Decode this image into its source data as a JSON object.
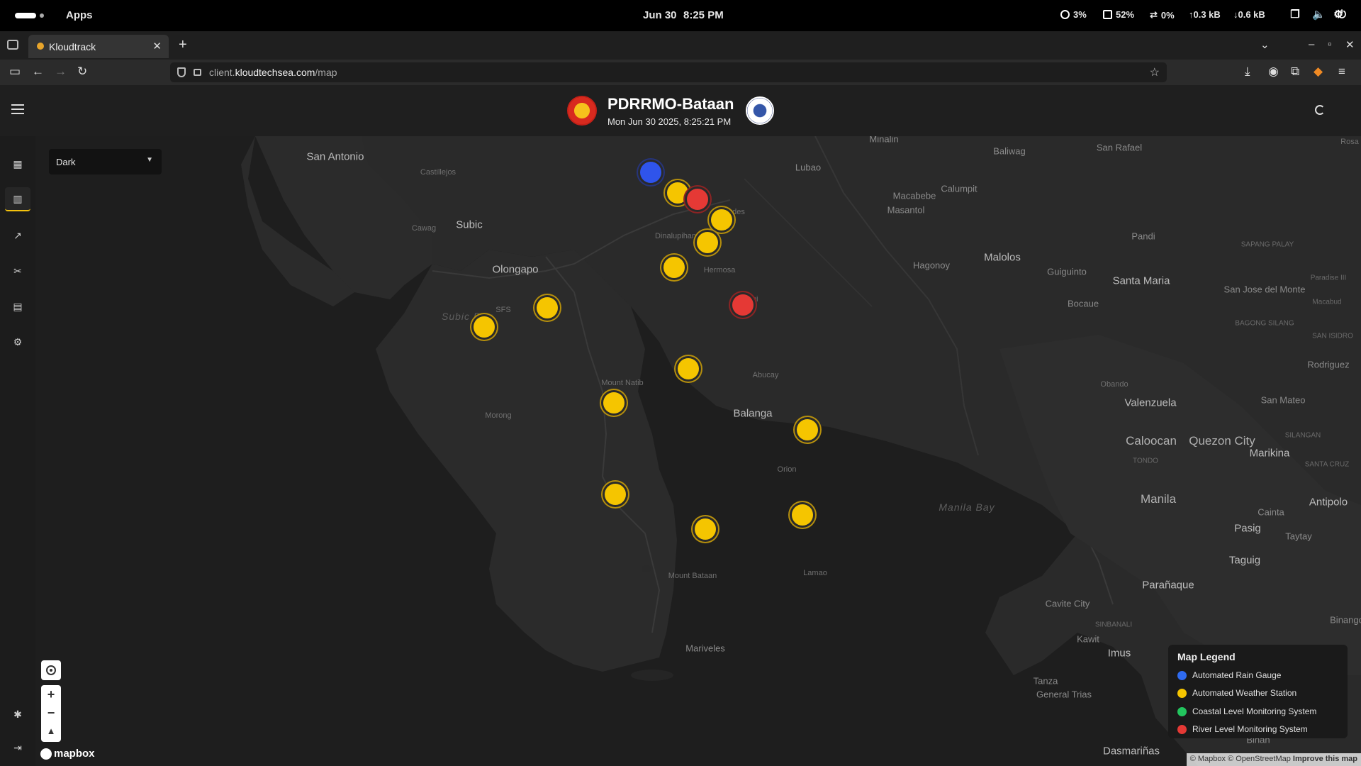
{
  "os": {
    "apps_label": "Apps",
    "date": "Jun 30",
    "time": "8:25 PM",
    "cpu": "3%",
    "memory": "52%",
    "swap": "0%",
    "net_up": "↑0.3 kB",
    "net_down": "↓0.6 kB"
  },
  "browser": {
    "tab_title": "Kloudtrack",
    "url_prefix": "client.",
    "url_domain": "kloudtechsea.com",
    "url_path": "/map"
  },
  "header": {
    "title": "PDRRMO-Bataan",
    "datetime": "Mon Jun 30 2025, 8:25:21 PM"
  },
  "map": {
    "style_select": "Dark",
    "attribution": "© Mapbox © OpenStreetMap",
    "improve_link": "Improve this map",
    "mapbox_label": "mapbox",
    "places": {
      "san_antonio": "San Antonio",
      "castillejos": "Castillejos",
      "subic": "Subic",
      "cawag": "Cawag",
      "olongapo": "Olongapo",
      "sfs": "SFS",
      "subic_bay": "Subic Bay",
      "minalin": "Minalin",
      "lubao": "Lubao",
      "lourdes": "Lourdes",
      "baliwag": "Baliwag",
      "san_rafael": "San Rafael",
      "macabebe": "Macabebe",
      "calumpit": "Calumpit",
      "masantol": "Masantol",
      "hagonoy": "Hagonoy",
      "malolos": "Malolos",
      "guiguinto": "Guiguinto",
      "pandi": "Pandi",
      "sapang_palay": "SAPANG PALAY",
      "santa_maria": "Santa Maria",
      "san_jose_del_monte": "San Jose del Monte",
      "paradise_iii": "Paradise III",
      "macabud": "Macabud",
      "bocaue": "Bocaue",
      "bagong_silang": "BAGONG SILANG",
      "san_isidro": "SAN ISIDRO",
      "obando": "Obando",
      "rodriguez": "Rodriguez",
      "valenzuela": "Valenzuela",
      "san_mateo": "San Mateo",
      "caloocan": "Caloocan",
      "quezon_city": "Quezon City",
      "silangan": "SILANGAN",
      "tondo": "TONDO",
      "marikina": "Marikina",
      "santa_cruz": "SANTA CRUZ",
      "manila": "Manila",
      "antipolo": "Antipolo",
      "cainta": "Cainta",
      "pasig": "Pasig",
      "taytay": "Taytay",
      "taguig": "Taguig",
      "paranaque": "Parañaque",
      "cavite_city": "Cavite City",
      "sinbanali": "SINBANALI",
      "kawit": "Kawit",
      "imus": "Imus",
      "tanza": "Tanza",
      "general_trias": "General Trias",
      "dasmarinas": "Dasmariñas",
      "binan": "Biñan",
      "binangonan": "Binango",
      "manila_bay": "Manila Bay",
      "mount_natib": "Mount Natib",
      "morong": "Morong",
      "balanga": "Balanga",
      "orion": "Orion",
      "mount_bataan": "Mount Bataan",
      "lamao": "Lamao",
      "mariveles": "Mariveles",
      "dinalupihan": "Dinalupihan",
      "hermosa": "Hermosa",
      "orani": "Orani",
      "abucay": "Abucay",
      "rosario": "Rosa"
    }
  },
  "legend": {
    "title": "Map Legend",
    "items": [
      {
        "label": "Automated Rain Gauge",
        "color": "#2f6bf0"
      },
      {
        "label": "Automated Weather Station",
        "color": "#f5c500"
      },
      {
        "label": "Coastal Level Monitoring System",
        "color": "#22c55e"
      },
      {
        "label": "River Level Monitoring System",
        "color": "#e53935"
      }
    ]
  },
  "colors": {
    "weather_station": "#f5c500",
    "river_level": "#e53935",
    "rain_gauge": "#2f54eb",
    "accent": "#f4c20d"
  },
  "sidebar": {
    "icons": [
      "dashboard-icon",
      "map-icon",
      "chart-icon",
      "tools-icon",
      "report-icon",
      "settings-icon",
      "bug-icon",
      "logout-icon"
    ]
  }
}
